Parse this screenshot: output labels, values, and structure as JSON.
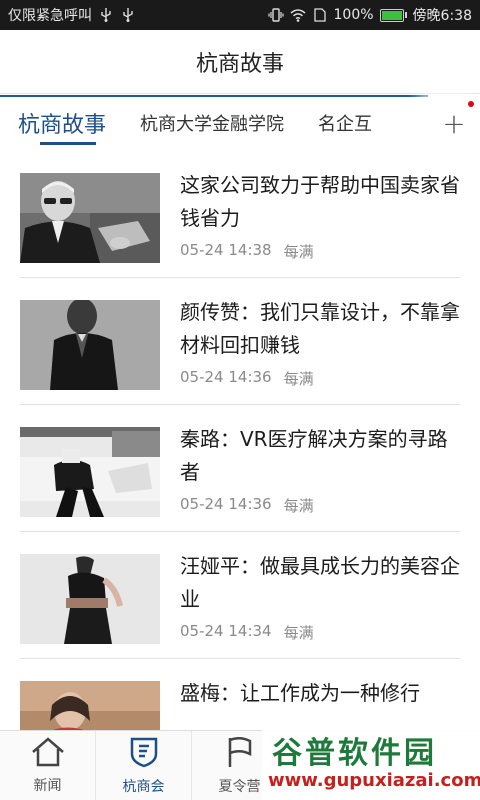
{
  "status_bar": {
    "carrier": "仅限紧急呼叫",
    "battery": "100%",
    "time": "傍晚6:38",
    "colors": {
      "background": "#1a1a1a",
      "battery_fill": "#3fbf3f"
    }
  },
  "header": {
    "title": "杭商故事"
  },
  "tabs": {
    "items": [
      {
        "label": "杭商故事",
        "active": true
      },
      {
        "label": "杭商大学金融学院",
        "active": false
      },
      {
        "label": "名企互",
        "active": false
      }
    ],
    "more_icon": "plus-icon",
    "accent_color": "#1e4f86"
  },
  "articles": [
    {
      "title": "这家公司致力于帮助中国卖家省钱省力",
      "date": "05-24 14:38",
      "source": "每满",
      "thumb": "man-with-glasses-photo"
    },
    {
      "title": "颜传赞：我们只靠设计，不靠拿材料回扣赚钱",
      "date": "05-24 14:36",
      "source": "每满",
      "thumb": "man-in-suit-photo"
    },
    {
      "title": "秦路：VR医疗解决方案的寻路者",
      "date": "05-24 14:36",
      "source": "每满",
      "thumb": "woman-on-sofa-photo"
    },
    {
      "title": "汪娅平：做最具成长力的美容企业",
      "date": "05-24 14:34",
      "source": "每满",
      "thumb": "woman-black-dress-photo"
    },
    {
      "title": "盛梅：让工作成为一种修行",
      "date": "",
      "source": "",
      "thumb": "woman-portrait-photo"
    }
  ],
  "bottom_nav": {
    "items": [
      {
        "label": "新闻",
        "icon": "house-icon",
        "active": false
      },
      {
        "label": "杭商会",
        "icon": "shield-icon",
        "active": true
      },
      {
        "label": "夏令营",
        "icon": "flag-icon",
        "active": false
      }
    ]
  },
  "watermark": {
    "brand": "谷普软件园",
    "url": "www.gupuxiazai.com"
  }
}
